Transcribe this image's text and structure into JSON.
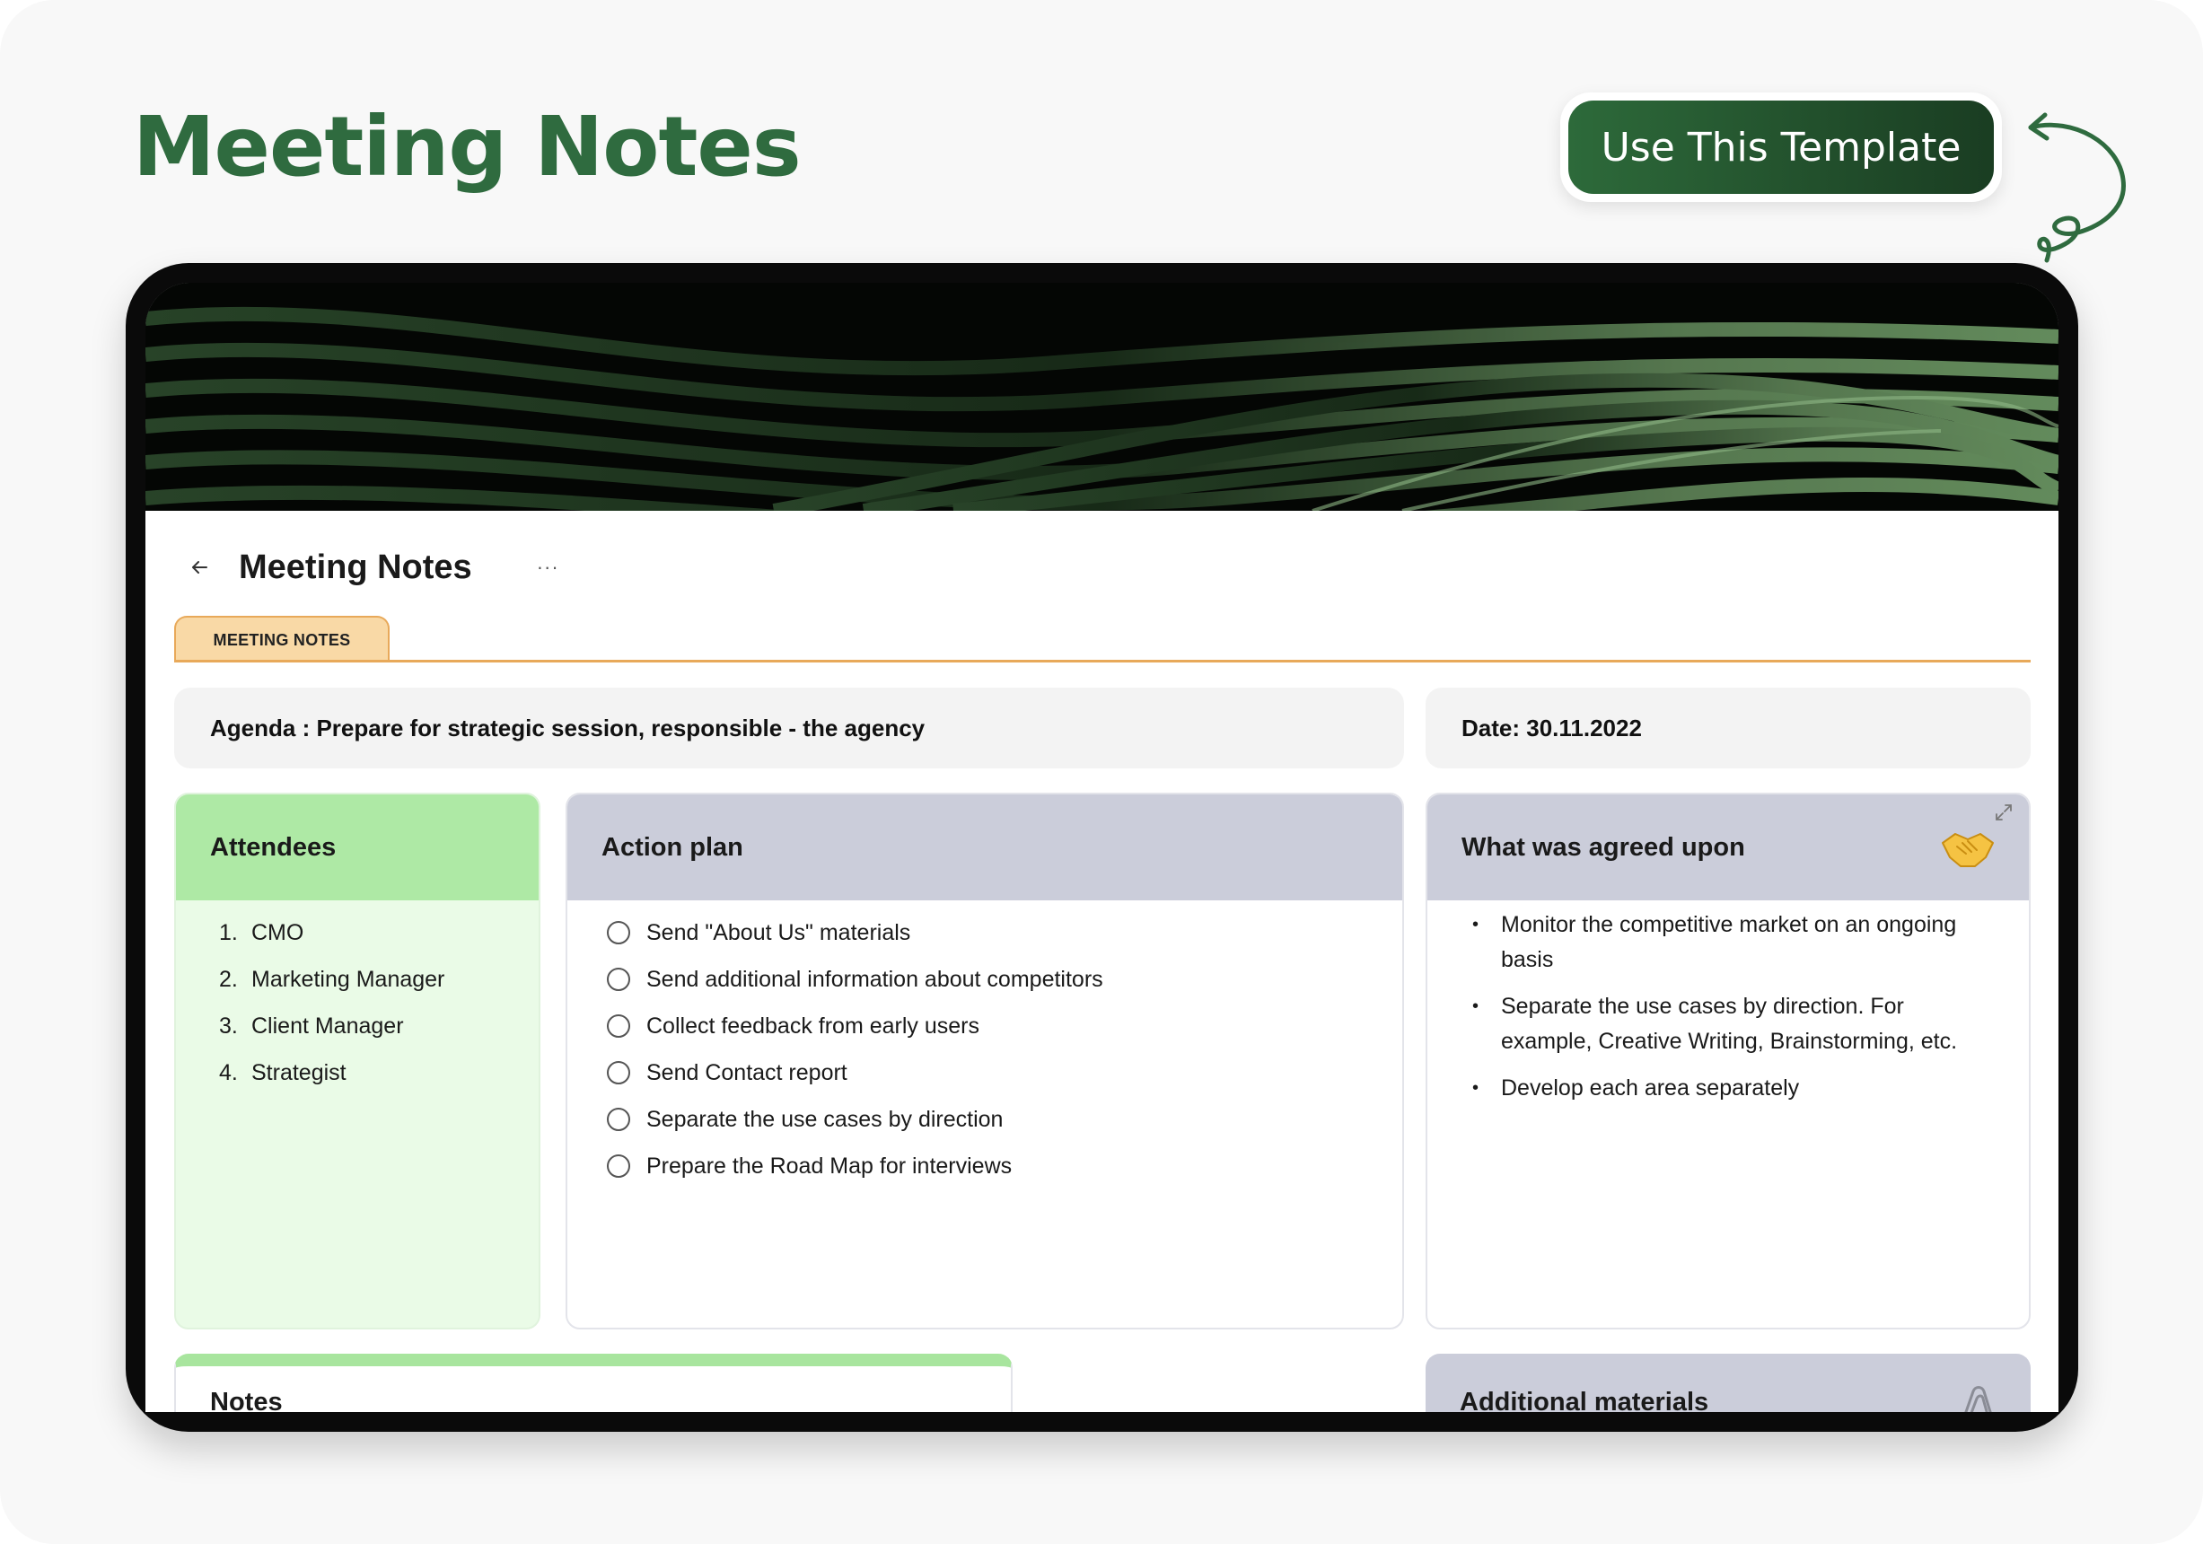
{
  "header": {
    "title": "Meeting Notes",
    "cta_label": "Use This Template"
  },
  "document": {
    "title": "Meeting Notes",
    "more_label": "···",
    "tab_label": "MEETING NOTES",
    "agenda": "Agenda : Prepare for strategic session, responsible - the agency",
    "date": "Date: 30.11.2022"
  },
  "attendees": {
    "title": "Attendees",
    "items": [
      {
        "num": "1.",
        "label": "CMO"
      },
      {
        "num": "2.",
        "label": "Marketing Manager"
      },
      {
        "num": "3.",
        "label": "Client Manager"
      },
      {
        "num": "4.",
        "label": "Strategist"
      }
    ]
  },
  "action_plan": {
    "title": "Action plan",
    "items": [
      "Send \"About Us\" materials",
      "Send additional information about competitors",
      "Collect feedback from early users",
      "Send Contact report",
      "Separate the use cases by direction",
      "Prepare the Road Map for interviews"
    ]
  },
  "agreed": {
    "title": "What was agreed upon",
    "bullet": "•",
    "items": [
      "Monitor the competitive market on an ongoing basis",
      "Separate the use cases by direction. For example, Creative Writing, Brainstorming, etc.",
      "Develop each area separately"
    ]
  },
  "notes": {
    "title": "Notes"
  },
  "additional": {
    "title": "Additional materials"
  },
  "colors": {
    "brand_green": "#2f6b3f",
    "attendees_head": "#aee9a5",
    "attendees_body": "#eafbe7",
    "panel_head": "#cbcdda",
    "tab_fill": "#f9d9a6",
    "tab_border": "#e8a95a"
  }
}
